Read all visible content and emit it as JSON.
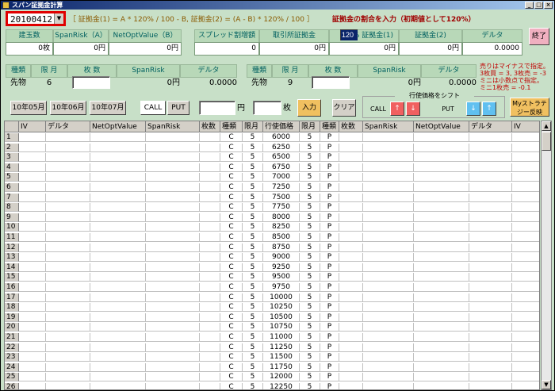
{
  "window": {
    "title": "スパン証拠金計算"
  },
  "date_select": {
    "value": "20100412"
  },
  "formula1": "［ 証拠金(1) = A * 120% / 100 - B,  証拠金(2) = (A - B) * 120% / 100 ］",
  "formula2": "証拠金の割合を入力（初期値として120%）",
  "top_headers": [
    "建玉数",
    "SpanRisk（A）",
    "NetOptValue（B）",
    "スプレッド割増額",
    "取引所証拠金",
    "% 証拠金(1)",
    "証拠金(2)",
    "デルタ"
  ],
  "top_values": [
    "0枚",
    "0円",
    "0円",
    "0",
    "0円",
    "0円",
    "0円",
    "0.0000"
  ],
  "percent_input": "120",
  "exit_button": "終了",
  "panel_left": {
    "headers": [
      "種類",
      "限 月",
      "枚 数",
      "SpanRisk",
      "デルタ"
    ],
    "kind": "先物",
    "month": "6",
    "qty": "",
    "spanrisk": "0円",
    "delta": "0.0000"
  },
  "panel_right": {
    "headers": [
      "種類",
      "限 月",
      "枚 数",
      "SpanRisk",
      "デルタ"
    ],
    "kind": "先物",
    "month": "9",
    "qty": "",
    "spanrisk": "0円",
    "delta": "0.0000"
  },
  "note": [
    "売りはマイナスで指定。",
    "3枚買 = 3, 3枚売 = -3",
    "ミニは小数点で指定。",
    "ミニ1枚売 = -0.1"
  ],
  "month_buttons": [
    "10年05月",
    "10年06月",
    "10年07月"
  ],
  "call_label": "CALL",
  "put_label": "PUT",
  "yen_unit": "円",
  "qty_unit": "枚",
  "input_button": "入力",
  "clear_button": "クリア",
  "shift_title": "行使価格をシフト",
  "shift_call": "CALL",
  "shift_put": "PUT",
  "up_arrow": "↑",
  "down_arrow": "↓",
  "my_strategy": "Myストラテジー反映",
  "grid": {
    "columns": [
      "IV",
      "デルタ",
      "NetOptValue",
      "SpanRisk",
      "枚数",
      "種類",
      "限月",
      "行使価格",
      "限月",
      "種類",
      "枚数",
      "SpanRisk",
      "NetOptValue",
      "デルタ",
      "IV"
    ],
    "rows": [
      {
        "n": "1",
        "c": "C",
        "m": "5",
        "k": "6000",
        "m2": "5",
        "p": "P"
      },
      {
        "n": "2",
        "c": "C",
        "m": "5",
        "k": "6250",
        "m2": "5",
        "p": "P"
      },
      {
        "n": "3",
        "c": "C",
        "m": "5",
        "k": "6500",
        "m2": "5",
        "p": "P"
      },
      {
        "n": "4",
        "c": "C",
        "m": "5",
        "k": "6750",
        "m2": "5",
        "p": "P"
      },
      {
        "n": "5",
        "c": "C",
        "m": "5",
        "k": "7000",
        "m2": "5",
        "p": "P"
      },
      {
        "n": "6",
        "c": "C",
        "m": "5",
        "k": "7250",
        "m2": "5",
        "p": "P"
      },
      {
        "n": "7",
        "c": "C",
        "m": "5",
        "k": "7500",
        "m2": "5",
        "p": "P"
      },
      {
        "n": "8",
        "c": "C",
        "m": "5",
        "k": "7750",
        "m2": "5",
        "p": "P"
      },
      {
        "n": "9",
        "c": "C",
        "m": "5",
        "k": "8000",
        "m2": "5",
        "p": "P"
      },
      {
        "n": "10",
        "c": "C",
        "m": "5",
        "k": "8250",
        "m2": "5",
        "p": "P"
      },
      {
        "n": "11",
        "c": "C",
        "m": "5",
        "k": "8500",
        "m2": "5",
        "p": "P"
      },
      {
        "n": "12",
        "c": "C",
        "m": "5",
        "k": "8750",
        "m2": "5",
        "p": "P"
      },
      {
        "n": "13",
        "c": "C",
        "m": "5",
        "k": "9000",
        "m2": "5",
        "p": "P"
      },
      {
        "n": "14",
        "c": "C",
        "m": "5",
        "k": "9250",
        "m2": "5",
        "p": "P"
      },
      {
        "n": "15",
        "c": "C",
        "m": "5",
        "k": "9500",
        "m2": "5",
        "p": "P"
      },
      {
        "n": "16",
        "c": "C",
        "m": "5",
        "k": "9750",
        "m2": "5",
        "p": "P"
      },
      {
        "n": "17",
        "c": "C",
        "m": "5",
        "k": "10000",
        "m2": "5",
        "p": "P"
      },
      {
        "n": "18",
        "c": "C",
        "m": "5",
        "k": "10250",
        "m2": "5",
        "p": "P"
      },
      {
        "n": "19",
        "c": "C",
        "m": "5",
        "k": "10500",
        "m2": "5",
        "p": "P"
      },
      {
        "n": "20",
        "c": "C",
        "m": "5",
        "k": "10750",
        "m2": "5",
        "p": "P"
      },
      {
        "n": "21",
        "c": "C",
        "m": "5",
        "k": "11000",
        "m2": "5",
        "p": "P"
      },
      {
        "n": "22",
        "c": "C",
        "m": "5",
        "k": "11250",
        "m2": "5",
        "p": "P"
      },
      {
        "n": "23",
        "c": "C",
        "m": "5",
        "k": "11500",
        "m2": "5",
        "p": "P"
      },
      {
        "n": "24",
        "c": "C",
        "m": "5",
        "k": "11750",
        "m2": "5",
        "p": "P"
      },
      {
        "n": "25",
        "c": "C",
        "m": "5",
        "k": "12000",
        "m2": "5",
        "p": "P"
      },
      {
        "n": "26",
        "c": "C",
        "m": "5",
        "k": "12250",
        "m2": "5",
        "p": "P"
      }
    ]
  }
}
